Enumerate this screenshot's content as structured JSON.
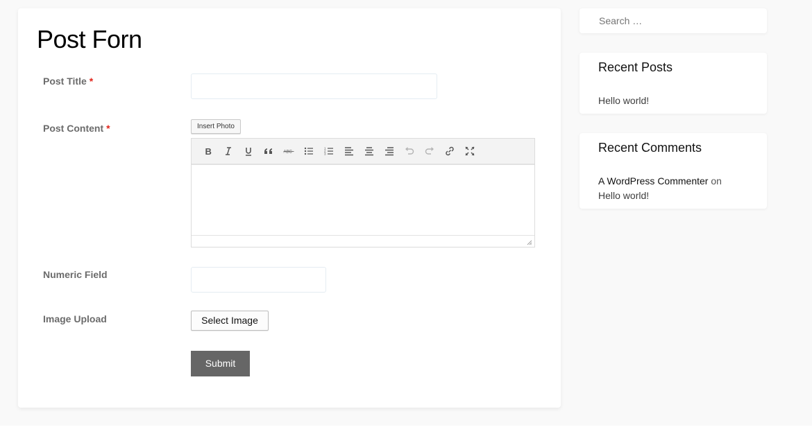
{
  "form": {
    "title": "Post Forn",
    "required_mark": "*",
    "fields": {
      "post_title": {
        "label": "Post Title",
        "value": "",
        "required": true
      },
      "post_content": {
        "label": "Post Content",
        "required": true,
        "insert_photo_label": "Insert Photo",
        "value": "",
        "toolbar": [
          {
            "name": "bold",
            "icon": "bold-icon",
            "enabled": true
          },
          {
            "name": "italic",
            "icon": "italic-icon",
            "enabled": true
          },
          {
            "name": "underline",
            "icon": "underline-icon",
            "enabled": true
          },
          {
            "name": "blockquote",
            "icon": "blockquote-icon",
            "enabled": true
          },
          {
            "name": "strikethrough",
            "icon": "strikethrough-icon",
            "enabled": true
          },
          {
            "name": "bulleted-list",
            "icon": "bullet-list-icon",
            "enabled": true
          },
          {
            "name": "numbered-list",
            "icon": "numbered-list-icon",
            "enabled": true
          },
          {
            "name": "align-left",
            "icon": "align-left-icon",
            "enabled": true
          },
          {
            "name": "align-center",
            "icon": "align-center-icon",
            "enabled": true
          },
          {
            "name": "align-right",
            "icon": "align-right-icon",
            "enabled": true
          },
          {
            "name": "undo",
            "icon": "undo-icon",
            "enabled": false
          },
          {
            "name": "redo",
            "icon": "redo-icon",
            "enabled": false
          },
          {
            "name": "link",
            "icon": "link-icon",
            "enabled": true
          },
          {
            "name": "fullscreen",
            "icon": "fullscreen-icon",
            "enabled": true
          }
        ]
      },
      "numeric_field": {
        "label": "Numeric Field",
        "value": ""
      },
      "image_upload": {
        "label": "Image Upload",
        "button_label": "Select Image"
      }
    },
    "submit_label": "Submit"
  },
  "sidebar": {
    "search": {
      "placeholder": "Search …",
      "value": ""
    },
    "recent_posts": {
      "title": "Recent Posts",
      "items": [
        "Hello world!"
      ]
    },
    "recent_comments": {
      "title": "Recent Comments",
      "items": [
        {
          "author": "A WordPress Commenter",
          "connector": "on",
          "post": "Hello world!"
        }
      ]
    }
  },
  "colors": {
    "required": "#e2261c",
    "submit_bg": "#666666",
    "page_bg": "#f9f9f9"
  }
}
